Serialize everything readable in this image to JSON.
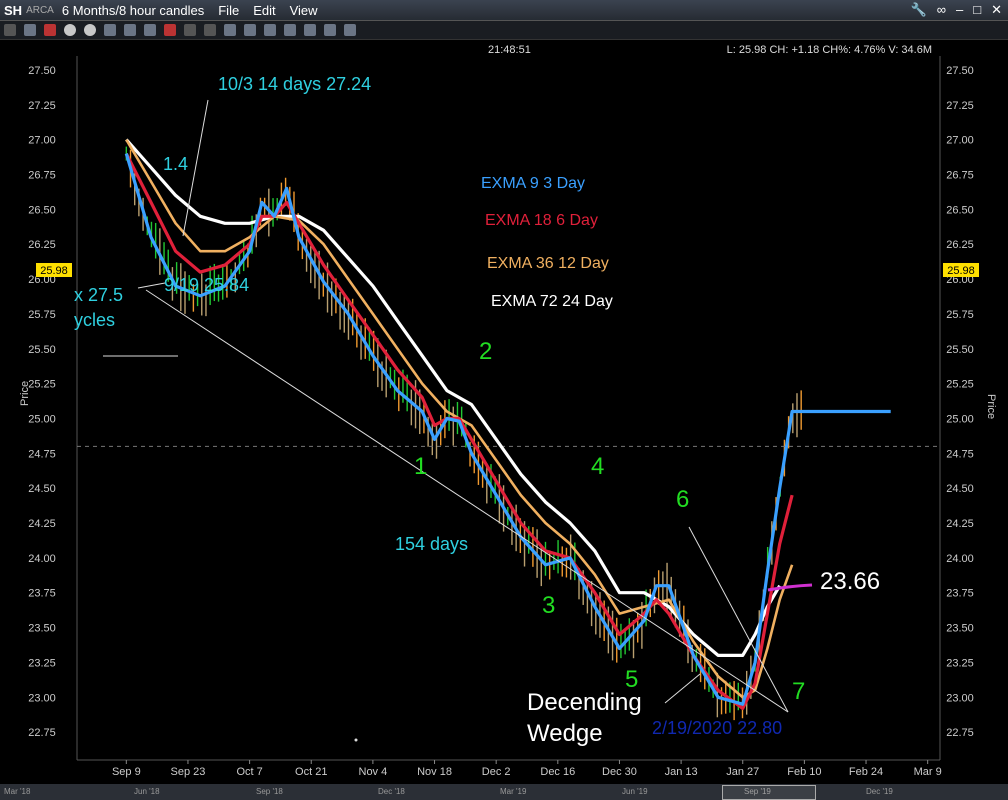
{
  "menubar": {
    "symbol": "SH",
    "exchange": "ARCA",
    "timeframe": "6 Months/8 hour candles",
    "menus": [
      "File",
      "Edit",
      "View"
    ]
  },
  "header": {
    "time": "21:48:51",
    "quote": "L: 25.98 CH: +1.18 CH%: 4.76% V: 34.6M"
  },
  "price_axis_label": "Price",
  "last_price_tag": "25.98",
  "annotations": {
    "top_note": "10/3 14 days 27.24",
    "small_note": "1.4",
    "low_note": "9/19 25.84",
    "left_clip_1": "x 27.5",
    "left_clip_2": "ycles",
    "duration": "154 days",
    "wedge_1": "Decending",
    "wedge_2": "Wedge",
    "low_date": "2/19/2020 22.80",
    "level": "23.66",
    "waves": [
      "1",
      "2",
      "3",
      "4",
      "5",
      "6",
      "7"
    ]
  },
  "legend": [
    {
      "label": "EXMA 9 3 Day",
      "color": "#3aa0ff"
    },
    {
      "label": "EXMA 18 6 Day",
      "color": "#e0203a"
    },
    {
      "label": "EXMA 36 12 Day",
      "color": "#f0b060"
    },
    {
      "label": "EXMA 72 24 Day",
      "color": "#ffffff"
    }
  ],
  "timebar_labels": [
    "Mar '18",
    "Jun '18",
    "Sep '18",
    "Dec '18",
    "Mar '19",
    "Jun '19",
    "Sep '19",
    "Dec '19"
  ],
  "chart_data": {
    "type": "line",
    "x_labels": [
      "Sep 9",
      "Sep 23",
      "Oct 7",
      "Oct 21",
      "Nov 4",
      "Nov 18",
      "Dec 2",
      "Dec 16",
      "Dec 30",
      "Jan 13",
      "Jan 27",
      "Feb 10",
      "Feb 24",
      "Mar 9"
    ],
    "y_ticks": [
      "27.50",
      "27.25",
      "27.00",
      "26.75",
      "26.50",
      "26.25",
      "26.00",
      "25.75",
      "25.50",
      "25.25",
      "25.00",
      "24.75",
      "24.50",
      "24.25",
      "24.00",
      "23.75",
      "23.50",
      "23.25",
      "23.00",
      "22.75"
    ],
    "ylim": [
      22.55,
      27.6
    ],
    "ylabel": "Price",
    "x_day_range": [
      -4,
      66
    ],
    "dashed_level": 24.8,
    "grid": false,
    "series": [
      {
        "name": "EXMA 9 3 Day",
        "color": "#3aa0ff",
        "x": [
          0,
          2,
          4,
          6,
          8,
          10,
          11,
          12,
          13,
          14,
          16,
          18,
          20,
          22,
          24,
          25,
          26,
          27,
          28,
          30,
          32,
          34,
          36,
          38,
          40,
          42,
          43,
          44,
          46,
          48,
          50,
          51,
          52,
          53,
          54,
          56,
          57,
          58,
          59,
          60,
          61,
          62
        ],
        "y": [
          26.9,
          26.3,
          25.95,
          25.88,
          25.95,
          26.2,
          26.55,
          26.45,
          26.65,
          26.3,
          25.98,
          25.75,
          25.45,
          25.2,
          25.05,
          24.85,
          25.0,
          24.98,
          24.75,
          24.45,
          24.15,
          23.95,
          24.0,
          23.65,
          23.35,
          23.55,
          23.8,
          23.8,
          23.3,
          23.0,
          22.95,
          23.25,
          23.9,
          24.5,
          25.05,
          25.05,
          25.05,
          25.05,
          25.05,
          25.05,
          25.05,
          25.05
        ]
      },
      {
        "name": "EXMA 18 6 Day",
        "color": "#e0203a",
        "x": [
          0,
          2,
          4,
          6,
          8,
          10,
          11,
          12,
          13,
          14,
          16,
          18,
          20,
          22,
          24,
          25,
          26,
          27,
          28,
          30,
          32,
          34,
          36,
          38,
          40,
          42,
          43,
          44,
          46,
          48,
          50,
          51,
          52,
          53,
          54
        ],
        "y": [
          26.9,
          26.55,
          26.2,
          26.05,
          26.1,
          26.25,
          26.45,
          26.45,
          26.55,
          26.4,
          26.1,
          25.85,
          25.6,
          25.35,
          25.15,
          24.95,
          25.0,
          25.0,
          24.85,
          24.55,
          24.25,
          24.05,
          24.0,
          23.75,
          23.45,
          23.6,
          23.7,
          23.6,
          23.3,
          23.05,
          22.92,
          23.1,
          23.6,
          24.1,
          24.45
        ]
      },
      {
        "name": "EXMA 36 12 Day",
        "color": "#f0b060",
        "x": [
          0,
          2,
          4,
          6,
          8,
          10,
          12,
          14,
          16,
          18,
          20,
          22,
          24,
          26,
          28,
          30,
          32,
          34,
          36,
          38,
          40,
          42,
          44,
          46,
          48,
          50,
          51,
          52,
          53,
          54
        ],
        "y": [
          27.0,
          26.7,
          26.4,
          26.2,
          26.2,
          26.3,
          26.45,
          26.42,
          26.25,
          26.0,
          25.75,
          25.5,
          25.25,
          25.05,
          24.95,
          24.7,
          24.45,
          24.25,
          24.1,
          23.88,
          23.6,
          23.65,
          23.7,
          23.4,
          23.15,
          23.0,
          23.05,
          23.35,
          23.7,
          23.95
        ]
      },
      {
        "name": "EXMA 72 24 Day",
        "color": "#ffffff",
        "x": [
          0,
          2,
          4,
          6,
          8,
          10,
          12,
          14,
          16,
          18,
          20,
          22,
          24,
          26,
          28,
          30,
          32,
          34,
          36,
          38,
          40,
          42,
          44,
          46,
          48,
          50,
          51,
          52,
          53
        ],
        "y": [
          27.0,
          26.8,
          26.6,
          26.45,
          26.4,
          26.4,
          26.45,
          26.45,
          26.35,
          26.15,
          25.95,
          25.7,
          25.45,
          25.2,
          25.1,
          24.85,
          24.6,
          24.4,
          24.25,
          24.05,
          23.75,
          23.75,
          23.65,
          23.45,
          23.3,
          23.3,
          23.45,
          23.65,
          23.8
        ]
      }
    ]
  }
}
